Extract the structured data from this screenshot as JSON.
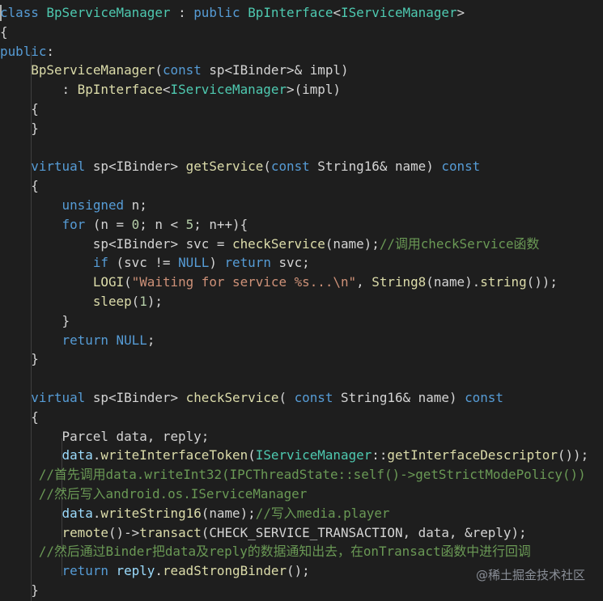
{
  "code": [
    [
      [
        "kw",
        "class"
      ],
      [
        "pl",
        " "
      ],
      [
        "ty",
        "BpServiceManager"
      ],
      [
        "pl",
        " : "
      ],
      [
        "kw",
        "public"
      ],
      [
        "pl",
        " "
      ],
      [
        "ty",
        "BpInterface"
      ],
      [
        "pl",
        "<"
      ],
      [
        "ty",
        "IServiceManager"
      ],
      [
        "pl",
        ">"
      ]
    ],
    [
      [
        "pl",
        "{"
      ]
    ],
    [
      [
        "kw",
        "public"
      ],
      [
        "pl",
        ":"
      ]
    ],
    [
      [
        "pl",
        "    "
      ],
      [
        "fn",
        "BpServiceManager"
      ],
      [
        "pl",
        "("
      ],
      [
        "kw",
        "const"
      ],
      [
        "pl",
        " sp<IBinder>& impl)"
      ]
    ],
    [
      [
        "pl",
        "        : "
      ],
      [
        "fn",
        "BpInterface"
      ],
      [
        "pl",
        "<"
      ],
      [
        "ty",
        "IServiceManager"
      ],
      [
        "pl",
        ">(impl)"
      ]
    ],
    [
      [
        "pl",
        "    {"
      ]
    ],
    [
      [
        "pl",
        "    }"
      ]
    ],
    [],
    [
      [
        "pl",
        "    "
      ],
      [
        "kw",
        "virtual"
      ],
      [
        "pl",
        " sp<IBinder> "
      ],
      [
        "fn",
        "getService"
      ],
      [
        "pl",
        "("
      ],
      [
        "kw",
        "const"
      ],
      [
        "pl",
        " String16& name) "
      ],
      [
        "kw",
        "const"
      ]
    ],
    [
      [
        "pl",
        "    {"
      ]
    ],
    [
      [
        "pl",
        "        "
      ],
      [
        "kw",
        "unsigned"
      ],
      [
        "pl",
        " n;"
      ]
    ],
    [
      [
        "pl",
        "        "
      ],
      [
        "kw",
        "for"
      ],
      [
        "pl",
        " (n = "
      ],
      [
        "num",
        "0"
      ],
      [
        "pl",
        "; n < "
      ],
      [
        "num",
        "5"
      ],
      [
        "pl",
        "; n++){"
      ]
    ],
    [
      [
        "pl",
        "            sp<IBinder> svc = "
      ],
      [
        "fn",
        "checkService"
      ],
      [
        "pl",
        "(name);"
      ],
      [
        "cm",
        "//调用checkService函数"
      ]
    ],
    [
      [
        "pl",
        "            "
      ],
      [
        "kw",
        "if"
      ],
      [
        "pl",
        " (svc != "
      ],
      [
        "kw",
        "NULL"
      ],
      [
        "pl",
        ") "
      ],
      [
        "kw",
        "return"
      ],
      [
        "pl",
        " svc;"
      ]
    ],
    [
      [
        "pl",
        "            "
      ],
      [
        "fn",
        "LOGI"
      ],
      [
        "pl",
        "("
      ],
      [
        "str",
        "\"Waiting for service %s...\\n\""
      ],
      [
        "pl",
        ", "
      ],
      [
        "fn",
        "String8"
      ],
      [
        "pl",
        "(name)."
      ],
      [
        "fn",
        "string"
      ],
      [
        "pl",
        "());"
      ]
    ],
    [
      [
        "pl",
        "            "
      ],
      [
        "fn",
        "sleep"
      ],
      [
        "pl",
        "("
      ],
      [
        "num",
        "1"
      ],
      [
        "pl",
        ");"
      ]
    ],
    [
      [
        "pl",
        "        }"
      ]
    ],
    [
      [
        "pl",
        "        "
      ],
      [
        "kw",
        "return"
      ],
      [
        "pl",
        " "
      ],
      [
        "kw",
        "NULL"
      ],
      [
        "pl",
        ";"
      ]
    ],
    [
      [
        "pl",
        "    }"
      ]
    ],
    [],
    [
      [
        "pl",
        "    "
      ],
      [
        "kw",
        "virtual"
      ],
      [
        "pl",
        " sp<IBinder> "
      ],
      [
        "fn",
        "checkService"
      ],
      [
        "pl",
        "( "
      ],
      [
        "kw",
        "const"
      ],
      [
        "pl",
        " String16& name) "
      ],
      [
        "kw",
        "const"
      ]
    ],
    [
      [
        "pl",
        "    {"
      ]
    ],
    [
      [
        "pl",
        "        Parcel data, reply;"
      ]
    ],
    [
      [
        "pl",
        "        "
      ],
      [
        "vr",
        "data"
      ],
      [
        "pl",
        "."
      ],
      [
        "fn",
        "writeInterfaceToken"
      ],
      [
        "pl",
        "("
      ],
      [
        "ty",
        "IServiceManager"
      ],
      [
        "pl",
        "::"
      ],
      [
        "fn",
        "getInterfaceDescriptor"
      ],
      [
        "pl",
        "());"
      ]
    ],
    [
      [
        "pl",
        "     "
      ],
      [
        "cm",
        "//首先调用data.writeInt32(IPCThreadState::self()->getStrictModePolicy())"
      ]
    ],
    [
      [
        "pl",
        "     "
      ],
      [
        "cm",
        "//然后写入android.os.IServiceManager"
      ]
    ],
    [
      [
        "pl",
        "        "
      ],
      [
        "vr",
        "data"
      ],
      [
        "pl",
        "."
      ],
      [
        "fn",
        "writeString16"
      ],
      [
        "pl",
        "(name);"
      ],
      [
        "cm",
        "//写入media.player"
      ]
    ],
    [
      [
        "pl",
        "        "
      ],
      [
        "fn",
        "remote"
      ],
      [
        "pl",
        "()->"
      ],
      [
        "fn",
        "transact"
      ],
      [
        "pl",
        "(CHECK_SERVICE_TRANSACTION, data, &reply);"
      ]
    ],
    [
      [
        "pl",
        "     "
      ],
      [
        "cm",
        "//然后通过Binder把data及reply的数据通知出去，在onTransact函数中进行回调"
      ]
    ],
    [
      [
        "pl",
        "        "
      ],
      [
        "kw",
        "return"
      ],
      [
        "pl",
        " "
      ],
      [
        "vr",
        "reply"
      ],
      [
        "pl",
        "."
      ],
      [
        "fn",
        "readStrongBinder"
      ],
      [
        "pl",
        "();"
      ]
    ],
    [
      [
        "pl",
        "    }"
      ]
    ]
  ],
  "watermark": "@稀土掘金技术社区"
}
